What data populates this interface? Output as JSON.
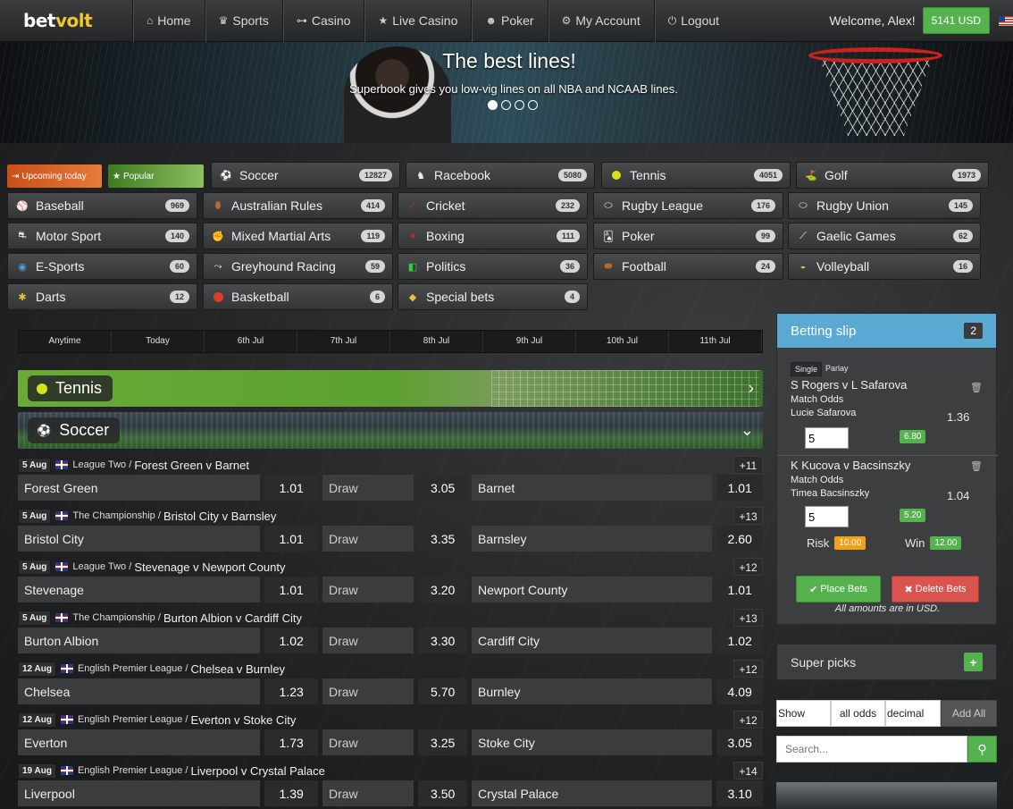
{
  "nav": {
    "logo_a": "bet",
    "logo_b": "volt",
    "items": [
      {
        "label": "Home",
        "icon": "home-icon"
      },
      {
        "label": "Sports",
        "icon": "trophy-icon"
      },
      {
        "label": "Casino",
        "icon": "gamepad-icon"
      },
      {
        "label": "Live Casino",
        "icon": "star-icon"
      },
      {
        "label": "Poker",
        "icon": "users-icon"
      },
      {
        "label": "My Account",
        "icon": "cogs-icon"
      },
      {
        "label": "Logout",
        "icon": "power-icon"
      }
    ],
    "welcome": "Welcome, Alex!",
    "balance": "5141 USD"
  },
  "hero": {
    "title": "The best lines!",
    "subtitle": "Superbook gives you low-vig lines on all NBA and NCAAB lines."
  },
  "specials": {
    "upcoming": "Upcoming today",
    "popular": "Popular"
  },
  "sports": [
    {
      "label": "Soccer",
      "count": "12827"
    },
    {
      "label": "Racebook",
      "count": "5080"
    },
    {
      "label": "Tennis",
      "count": "4051"
    },
    {
      "label": "Golf",
      "count": "1973"
    },
    {
      "label": "Baseball",
      "count": "969"
    },
    {
      "label": "Australian Rules",
      "count": "414"
    },
    {
      "label": "Cricket",
      "count": "232"
    },
    {
      "label": "Rugby League",
      "count": "176"
    },
    {
      "label": "Rugby Union",
      "count": "145"
    },
    {
      "label": "Motor Sport",
      "count": "140"
    },
    {
      "label": "Mixed Martial Arts",
      "count": "119"
    },
    {
      "label": "Boxing",
      "count": "111"
    },
    {
      "label": "Poker",
      "count": "99"
    },
    {
      "label": "Gaelic Games",
      "count": "62"
    },
    {
      "label": "E-Sports",
      "count": "60"
    },
    {
      "label": "Greyhound Racing",
      "count": "59"
    },
    {
      "label": "Politics",
      "count": "36"
    },
    {
      "label": "Football",
      "count": "24"
    },
    {
      "label": "Volleyball",
      "count": "16"
    },
    {
      "label": "Darts",
      "count": "12"
    },
    {
      "label": "Basketball",
      "count": "6"
    },
    {
      "label": "Special bets",
      "count": "4"
    }
  ],
  "dates": [
    "Anytime",
    "Today",
    "6th Jul",
    "7th Jul",
    "8th Jul",
    "9th Jul",
    "10th Jul",
    "11th Jul"
  ],
  "banners": {
    "tennis": "Tennis",
    "soccer": "Soccer"
  },
  "matches": [
    {
      "date": "5 Aug",
      "league": "League Two",
      "title": "Forest Green v Barnet",
      "more": "+11",
      "home": "Forest Green",
      "home_odd": "1.01",
      "draw": "Draw",
      "draw_odd": "3.05",
      "away": "Barnet",
      "away_odd": "1.01"
    },
    {
      "date": "5 Aug",
      "league": "The Championship",
      "title": "Bristol City v Barnsley",
      "more": "+13",
      "home": "Bristol City",
      "home_odd": "1.01",
      "draw": "Draw",
      "draw_odd": "3.35",
      "away": "Barnsley",
      "away_odd": "2.60"
    },
    {
      "date": "5 Aug",
      "league": "League Two",
      "title": "Stevenage v Newport County",
      "more": "+12",
      "home": "Stevenage",
      "home_odd": "1.01",
      "draw": "Draw",
      "draw_odd": "3.20",
      "away": "Newport County",
      "away_odd": "1.01"
    },
    {
      "date": "5 Aug",
      "league": "The Championship",
      "title": "Burton Albion v Cardiff City",
      "more": "+13",
      "home": "Burton Albion",
      "home_odd": "1.02",
      "draw": "Draw",
      "draw_odd": "3.30",
      "away": "Cardiff City",
      "away_odd": "1.02"
    },
    {
      "date": "12 Aug",
      "league": "English Premier League",
      "title": "Chelsea v Burnley",
      "more": "+12",
      "home": "Chelsea",
      "home_odd": "1.23",
      "draw": "Draw",
      "draw_odd": "5.70",
      "away": "Burnley",
      "away_odd": "4.09"
    },
    {
      "date": "12 Aug",
      "league": "English Premier League",
      "title": "Everton v Stoke City",
      "more": "+12",
      "home": "Everton",
      "home_odd": "1.73",
      "draw": "Draw",
      "draw_odd": "3.25",
      "away": "Stoke City",
      "away_odd": "3.05"
    },
    {
      "date": "19 Aug",
      "league": "English Premier League",
      "title": "Liverpool v Crystal Palace",
      "more": "+14",
      "home": "Liverpool",
      "home_odd": "1.39",
      "draw": "Draw",
      "draw_odd": "3.50",
      "away": "Crystal Palace",
      "away_odd": "3.10"
    }
  ],
  "slip": {
    "title": "Betting slip",
    "count": "2",
    "tab_single": "Single",
    "tab_parlay": "Parlay",
    "bets": [
      {
        "event": "S Rogers v L Safarova",
        "market": "Match Odds",
        "selection": "Lucie Safarova",
        "odd": "1.36",
        "stake": "5",
        "win": "6.80"
      },
      {
        "event": "K Kucova v Bacsinszky",
        "market": "Match Odds",
        "selection": "Timea Bacsinszky",
        "odd": "1.04",
        "stake": "5",
        "win": "5.20"
      }
    ],
    "risk_label": "Risk",
    "risk": "10.00",
    "win_label": "Win",
    "win": "12.00",
    "place": "Place Bets",
    "delete": "Delete Bets",
    "note": "All amounts are in USD."
  },
  "super": {
    "title": "Super picks",
    "show": "Show",
    "odds_filter": "all odds",
    "format": "decimal",
    "add_all": "Add All",
    "search_placeholder": "Search..."
  },
  "colors": {
    "accent": "#55b24f",
    "slip_header": "#5aa9d3",
    "danger": "#d9534f",
    "risk": "#f0a11b",
    "logo_accent": "#f3c623"
  }
}
